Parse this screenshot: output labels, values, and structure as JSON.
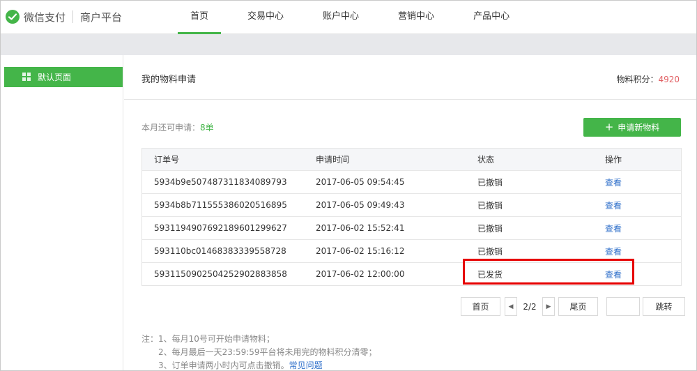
{
  "header": {
    "brand": "微信支付",
    "brand_sub": "商户平台",
    "nav": [
      "首页",
      "交易中心",
      "账户中心",
      "营销中心",
      "产品中心"
    ]
  },
  "sidebar": {
    "items": [
      {
        "label": "默认页面"
      }
    ]
  },
  "main": {
    "title": "我的物料申请",
    "points_label": "物料积分：",
    "points_value": "4920",
    "remain_label": "本月还可申请：",
    "remain_value": "8单",
    "apply_button": "申请新物料",
    "table": {
      "headers": [
        "订单号",
        "申请时间",
        "状态",
        "操作"
      ],
      "rows": [
        {
          "order": "5934b9e507487311834089793",
          "time": "2017-06-05 09:54:45",
          "status": "已撤销",
          "action": "查看"
        },
        {
          "order": "5934b8b711555386020516895",
          "time": "2017-06-05 09:49:43",
          "status": "已撤销",
          "action": "查看"
        },
        {
          "order": "593119490769218960129962​7",
          "time": "2017-06-02 15:52:41",
          "status": "已撤销",
          "action": "查看"
        },
        {
          "order": "593110bc01468383339558728",
          "time": "2017-06-02 15:16:12",
          "status": "已撤销",
          "action": "查看"
        },
        {
          "order": "593115090250425290288385​8",
          "time": "2017-06-02 12:00:00",
          "status": "已发货",
          "action": "查看"
        }
      ]
    },
    "pager": {
      "first": "首页",
      "info": "2/2",
      "last": "尾页",
      "jump": "跳转"
    },
    "notes": {
      "line1": "注：1、每月10号可开始申请物料；",
      "line2": "2、每月最后一天23:59:59平台将未用完的物料积分清零；",
      "line3": "3、订单申请两小时内可点击撤销。",
      "faq": "常见问题"
    }
  },
  "colors": {
    "accent": "#44b549",
    "points": "#e15f63",
    "link": "#2f6fca",
    "highlight": "#e60000"
  }
}
